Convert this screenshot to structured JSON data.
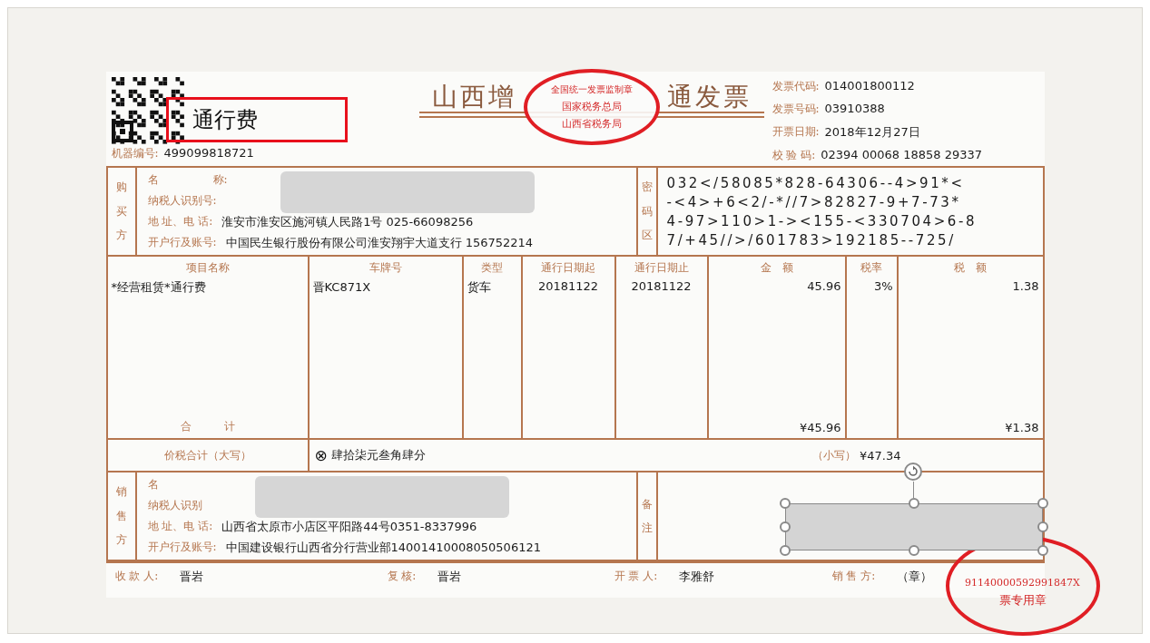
{
  "header": {
    "qr_note": "通行费",
    "machine_no_label": "机器编号:",
    "machine_no": "499099818721",
    "title_left": "山西增",
    "title_right": "通发票",
    "seal_lines": [
      "全国统一发票监制章",
      "国家税务总局",
      "山西省税务局"
    ],
    "meta": [
      {
        "label": "发票代码:",
        "value": "014001800112"
      },
      {
        "label": "发票号码:",
        "value": "03910388"
      },
      {
        "label": "开票日期:",
        "value": "2018年12月27日"
      },
      {
        "label": "校 验 码:",
        "value": "02394 00068 18858 29337"
      }
    ]
  },
  "buyer": {
    "side_label": "购买方",
    "redacted_labels": [
      "名　　　　　称:",
      "纳税人识别号:"
    ],
    "fields": [
      {
        "label": "地 址、电 话:",
        "value": "淮安市淮安区施河镇人民路1号 025-66098256"
      },
      {
        "label": "开户行及账号:",
        "value": "中国民生银行股份有限公司淮安翔宇大道支行 156752214"
      }
    ],
    "cipher_label": "密码区",
    "cipher_lines": [
      "032</58085*828-64306--4>91*<",
      "-<4>+6<2/-*//7>82827-9+7-73*",
      "4-97>110>1-><155-<330704>6-8",
      "7/+45//>/601783>192185--725/"
    ]
  },
  "items": {
    "columns": [
      "项目名称",
      "车牌号",
      "类型",
      "通行日期起",
      "通行日期止",
      "金　额",
      "税率",
      "税　额"
    ],
    "rows": [
      [
        "*经营租赁*通行费",
        "晋KC871X",
        "货车",
        "20181122",
        "20181122",
        "45.96",
        "3%",
        "1.38"
      ]
    ],
    "total_label": "合　　　计",
    "total_amount": "¥45.96",
    "total_tax": "¥1.38"
  },
  "grand_total": {
    "label": "价税合计（大写）",
    "icon": "⊗",
    "words": "肆拾柒元叁角肆分",
    "small_label": "（小写）",
    "small_value": "¥47.34"
  },
  "seller": {
    "side_label": "销售方",
    "redacted_labels": [
      "名",
      "纳税人识别"
    ],
    "fields": [
      {
        "label": "地 址、电 话:",
        "value": "山西省太原市小店区平阳路44号0351-8337996"
      },
      {
        "label": "开户行及账号:",
        "value": "中国建设银行山西省分行营业部14001410008050506121"
      }
    ],
    "remark_label": "备注"
  },
  "seller_seal": {
    "code": "91140000592991847X",
    "text": "票专用章"
  },
  "shape": {
    "selected": true
  },
  "footer": [
    {
      "label": "收 款 人:",
      "value": "晋岩"
    },
    {
      "label": "复 核:",
      "value": "晋岩"
    },
    {
      "label": "开 票 人:",
      "value": "李雅舒"
    },
    {
      "label": "销 售 方:",
      "value": "（章）"
    }
  ]
}
